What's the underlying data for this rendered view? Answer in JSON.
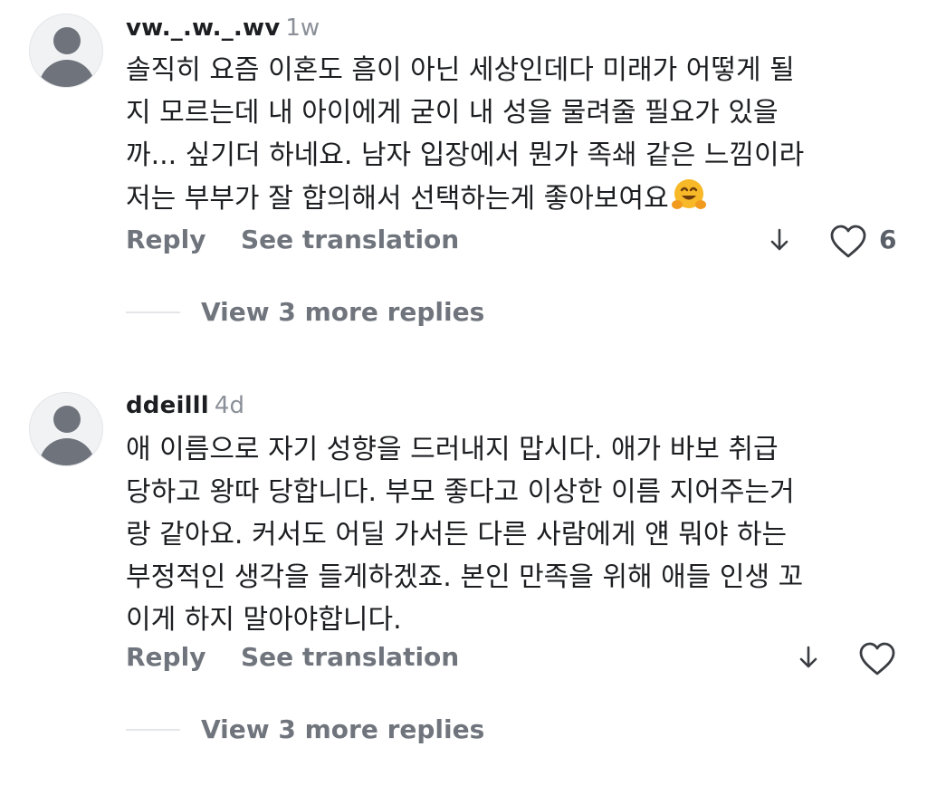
{
  "comments": [
    {
      "username": "vw._.w._.wv",
      "age": "1w",
      "lines": [
        "솔직히 요즘 이혼도 흠이 아닌 세상인데다 미래가 어떻게 될",
        "지 모르는데 내 아이에게 굳이 내 성을 물려줄 필요가 있을",
        "까... 싶기더 하네요. 남자 입장에서 뭔가 족쇄 같은 느낌이라",
        "저는 부부가 잘 합의해서 선택하는게 좋아보여요"
      ],
      "emoji": "hugging-face-emoji",
      "reply_label": "Reply",
      "translate_label": "See translation",
      "like_count": "6",
      "view_replies": "View 3 more replies"
    },
    {
      "username": "ddeilll",
      "age": "4d",
      "lines": [
        "애 이름으로 자기 성향을 드러내지 맙시다. 애가 바보 취급",
        "당하고 왕따 당합니다. 부모 좋다고 이상한 이름 지어주는거",
        "랑 같아요. 커서도 어딜 가서든 다른 사람에게 얜 뭐야 하는",
        "부정적인 생각을 들게하겠죠. 본인 만족을 위해 애들 인생 꼬",
        "이게 하지 말아야합니다."
      ],
      "reply_label": "Reply",
      "translate_label": "See translation",
      "view_replies": "View 3 more replies"
    }
  ],
  "colors": {
    "text": "#1c1e21",
    "muted": "#70757d",
    "avatar_bg": "#f1f2f4",
    "avatar_figure": "#6f747c",
    "emoji_yellow": "#f7b928"
  }
}
